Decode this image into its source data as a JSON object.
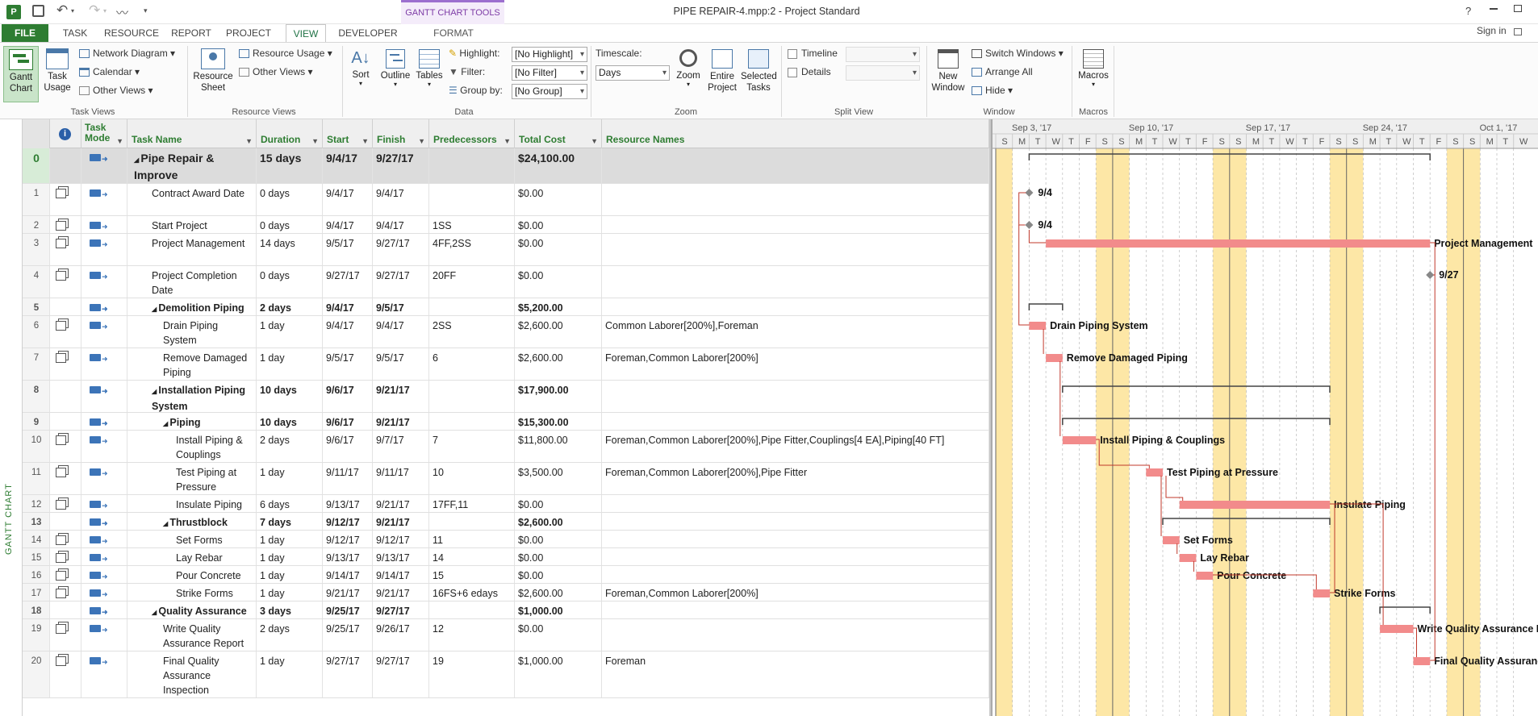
{
  "app": {
    "title": "PIPE REPAIR-4.mpp:2 - Project Standard",
    "help": "?",
    "sign_in": "Sign in",
    "context_tab": "GANTT CHART TOOLS"
  },
  "tabs": [
    "FILE",
    "TASK",
    "RESOURCE",
    "REPORT",
    "PROJECT",
    "VIEW",
    "DEVELOPER",
    "FORMAT"
  ],
  "active_tab": "VIEW",
  "ribbon": {
    "task_views": {
      "gantt": "Gantt Chart",
      "task_usage": "Task Usage",
      "network": "Network Diagram",
      "calendar": "Calendar",
      "other": "Other Views",
      "group": "Task Views"
    },
    "resource_views": {
      "sheet": "Resource Sheet",
      "usage": "Resource Usage",
      "other": "Other Views",
      "group": "Resource Views"
    },
    "data": {
      "sort": "Sort",
      "outline": "Outline",
      "tables": "Tables",
      "highlight_label": "Highlight:",
      "highlight": "[No Highlight]",
      "filter_label": "Filter:",
      "filter": "[No Filter]",
      "groupby_label": "Group by:",
      "groupby": "[No Group]",
      "group": "Data"
    },
    "zoom": {
      "timescale_label": "Timescale:",
      "timescale": "Days",
      "zoom": "Zoom",
      "entire": "Entire Project",
      "selected": "Selected Tasks",
      "group": "Zoom"
    },
    "split": {
      "timeline": "Timeline",
      "details": "Details",
      "group": "Split View"
    },
    "window": {
      "new": "New Window",
      "switch": "Switch Windows",
      "arrange": "Arrange All",
      "hide": "Hide",
      "group": "Window"
    },
    "macros": {
      "macros": "Macros",
      "group": "Macros"
    }
  },
  "vertical_label": "GANTT CHART",
  "columns": [
    "Task Mode",
    "Task Name",
    "Duration",
    "Start",
    "Finish",
    "Predecessors",
    "Total Cost",
    "Resource Names"
  ],
  "tasks": [
    {
      "id": "0",
      "name": "Pipe Repair & Improve",
      "dur": "15 days",
      "start": "9/4/17",
      "finish": "9/27/17",
      "pred": "",
      "cost": "$24,100.00",
      "res": "",
      "level": 0,
      "summary": true
    },
    {
      "id": "1",
      "name": "Contract Award Date",
      "dur": "0 days",
      "start": "9/4/17",
      "finish": "9/4/17",
      "pred": "",
      "cost": "$0.00",
      "res": "",
      "level": 1
    },
    {
      "id": "2",
      "name": "Start Project",
      "dur": "0 days",
      "start": "9/4/17",
      "finish": "9/4/17",
      "pred": "1SS",
      "cost": "$0.00",
      "res": "",
      "level": 1
    },
    {
      "id": "3",
      "name": "Project Management",
      "dur": "14 days",
      "start": "9/5/17",
      "finish": "9/27/17",
      "pred": "4FF,2SS",
      "cost": "$0.00",
      "res": "",
      "level": 1
    },
    {
      "id": "4",
      "name": "Project Completion Date",
      "dur": "0 days",
      "start": "9/27/17",
      "finish": "9/27/17",
      "pred": "20FF",
      "cost": "$0.00",
      "res": "",
      "level": 1
    },
    {
      "id": "5",
      "name": "Demolition Piping",
      "dur": "2 days",
      "start": "9/4/17",
      "finish": "9/5/17",
      "pred": "",
      "cost": "$5,200.00",
      "res": "",
      "level": 1,
      "summary": true
    },
    {
      "id": "6",
      "name": "Drain Piping System",
      "dur": "1 day",
      "start": "9/4/17",
      "finish": "9/4/17",
      "pred": "2SS",
      "cost": "$2,600.00",
      "res": "Common Laborer[200%],Foreman",
      "level": 2
    },
    {
      "id": "7",
      "name": "Remove Damaged Piping",
      "dur": "1 day",
      "start": "9/5/17",
      "finish": "9/5/17",
      "pred": "6",
      "cost": "$2,600.00",
      "res": "Foreman,Common Laborer[200%]",
      "level": 2
    },
    {
      "id": "8",
      "name": "Installation Piping System",
      "dur": "10 days",
      "start": "9/6/17",
      "finish": "9/21/17",
      "pred": "",
      "cost": "$17,900.00",
      "res": "",
      "level": 1,
      "summary": true
    },
    {
      "id": "9",
      "name": "Piping",
      "dur": "10 days",
      "start": "9/6/17",
      "finish": "9/21/17",
      "pred": "",
      "cost": "$15,300.00",
      "res": "",
      "level": 2,
      "summary": true
    },
    {
      "id": "10",
      "name": "Install Piping & Couplings",
      "dur": "2 days",
      "start": "9/6/17",
      "finish": "9/7/17",
      "pred": "7",
      "cost": "$11,800.00",
      "res": "Foreman,Common Laborer[200%],Pipe Fitter,Couplings[4 EA],Piping[40 FT]",
      "level": 3
    },
    {
      "id": "11",
      "name": "Test Piping at Pressure",
      "dur": "1 day",
      "start": "9/11/17",
      "finish": "9/11/17",
      "pred": "10",
      "cost": "$3,500.00",
      "res": "Foreman,Common Laborer[200%],Pipe Fitter",
      "level": 3
    },
    {
      "id": "12",
      "name": "Insulate Piping",
      "dur": "6 days",
      "start": "9/13/17",
      "finish": "9/21/17",
      "pred": "17FF,11",
      "cost": "$0.00",
      "res": "",
      "level": 3
    },
    {
      "id": "13",
      "name": "Thrustblock",
      "dur": "7 days",
      "start": "9/12/17",
      "finish": "9/21/17",
      "pred": "",
      "cost": "$2,600.00",
      "res": "",
      "level": 2,
      "summary": true
    },
    {
      "id": "14",
      "name": "Set Forms",
      "dur": "1 day",
      "start": "9/12/17",
      "finish": "9/12/17",
      "pred": "11",
      "cost": "$0.00",
      "res": "",
      "level": 3
    },
    {
      "id": "15",
      "name": "Lay Rebar",
      "dur": "1 day",
      "start": "9/13/17",
      "finish": "9/13/17",
      "pred": "14",
      "cost": "$0.00",
      "res": "",
      "level": 3
    },
    {
      "id": "16",
      "name": "Pour Concrete",
      "dur": "1 day",
      "start": "9/14/17",
      "finish": "9/14/17",
      "pred": "15",
      "cost": "$0.00",
      "res": "",
      "level": 3
    },
    {
      "id": "17",
      "name": "Strike Forms",
      "dur": "1 day",
      "start": "9/21/17",
      "finish": "9/21/17",
      "pred": "16FS+6 edays",
      "cost": "$2,600.00",
      "res": "Foreman,Common Laborer[200%]",
      "level": 3
    },
    {
      "id": "18",
      "name": "Quality Assurance",
      "dur": "3 days",
      "start": "9/25/17",
      "finish": "9/27/17",
      "pred": "",
      "cost": "$1,000.00",
      "res": "",
      "level": 1,
      "summary": true
    },
    {
      "id": "19",
      "name": "Write Quality Assurance Report",
      "dur": "2 days",
      "start": "9/25/17",
      "finish": "9/26/17",
      "pred": "12",
      "cost": "$0.00",
      "res": "",
      "level": 2
    },
    {
      "id": "20",
      "name": "Final Quality Assurance Inspection",
      "dur": "1 day",
      "start": "9/27/17",
      "finish": "9/27/17",
      "pred": "19",
      "cost": "$1,000.00",
      "res": "Foreman",
      "level": 2
    }
  ],
  "gantt": {
    "weeks": [
      "Sep 3, '17",
      "Sep 10, '17",
      "Sep 17, '17",
      "Sep 24, '17",
      "Oct 1, '17"
    ],
    "days": [
      "S",
      "M",
      "T",
      "W",
      "T",
      "F",
      "S",
      "S",
      "M",
      "T",
      "W",
      "T",
      "F",
      "S",
      "S",
      "M",
      "T",
      "W",
      "T",
      "F",
      "S",
      "S",
      "M",
      "T",
      "W",
      "T",
      "F",
      "S",
      "S",
      "M",
      "T",
      "W"
    ],
    "labels": {
      "m1": "9/4",
      "m2": "9/4",
      "t3": "Project Management",
      "m4": "9/27",
      "t6": "Drain Piping System",
      "t7": "Remove Damaged Piping",
      "t10": "Install Piping & Couplings",
      "t11": "Test Piping at Pressure",
      "t12": "Insulate Piping",
      "t14": "Set Forms",
      "t15": "Lay Rebar",
      "t16": "Pour Concrete",
      "t17": "Strike Forms",
      "t19": "Write Quality Assurance Report",
      "t20": "Final Quality Assurance Inspection"
    },
    "colors": {
      "bar": "#f28b8b",
      "weekend": "#fde7a6",
      "summary": "#333333",
      "link": "#c0392b"
    }
  }
}
